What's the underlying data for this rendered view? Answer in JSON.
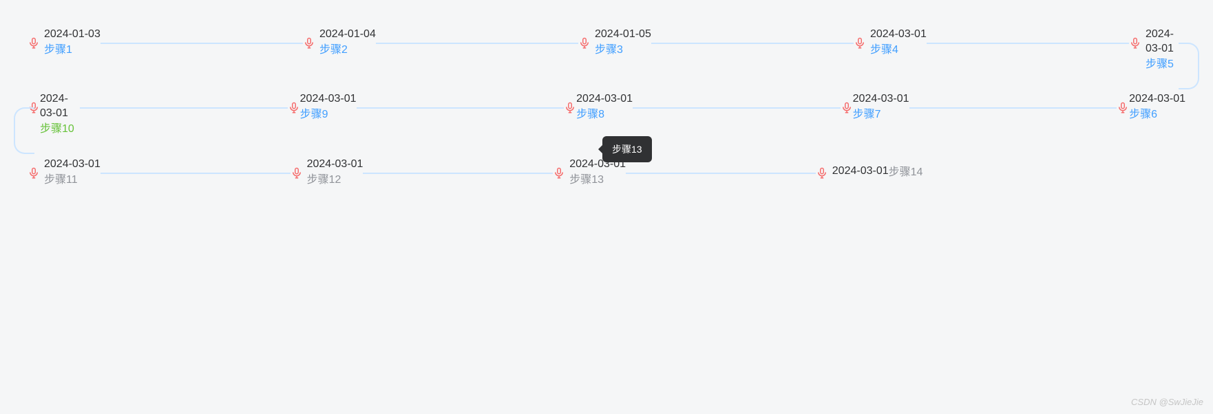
{
  "rows": [
    {
      "direction": "ltr",
      "items": [
        {
          "date": "2024-01-03",
          "step": "步骤1",
          "stepClass": "step-blue",
          "narrow": false
        },
        {
          "date": "2024-01-04",
          "step": "步骤2",
          "stepClass": "step-blue",
          "narrow": false
        },
        {
          "date": "2024-01-05",
          "step": "步骤3",
          "stepClass": "step-blue",
          "narrow": false
        },
        {
          "date": "2024-03-01",
          "step": "步骤4",
          "stepClass": "step-blue",
          "narrow": false
        },
        {
          "date": "2024-03-01",
          "step": "步骤5",
          "stepClass": "step-blue",
          "narrow": true
        }
      ],
      "snakeRight": true,
      "snakeLeft": false
    },
    {
      "direction": "rtl",
      "items": [
        {
          "date": "2024-03-01",
          "step": "步骤6",
          "stepClass": "step-blue",
          "narrow": false
        },
        {
          "date": "2024-03-01",
          "step": "步骤7",
          "stepClass": "step-blue",
          "narrow": false
        },
        {
          "date": "2024-03-01",
          "step": "步骤8",
          "stepClass": "step-blue",
          "narrow": false
        },
        {
          "date": "2024-03-01",
          "step": "步骤9",
          "stepClass": "step-blue",
          "narrow": false
        },
        {
          "date": "2024-03-01",
          "step": "步骤10",
          "stepClass": "step-green",
          "narrow": true
        }
      ],
      "snakeRight": false,
      "snakeLeft": true
    },
    {
      "direction": "ltr",
      "items": [
        {
          "date": "2024-03-01",
          "step": "步骤11",
          "stepClass": "step-gray",
          "narrow": false
        },
        {
          "date": "2024-03-01",
          "step": "步骤12",
          "stepClass": "step-gray",
          "narrow": false
        },
        {
          "date": "2024-03-01",
          "step": "步骤13",
          "stepClass": "step-gray",
          "narrow": false
        },
        {
          "date": "",
          "step": "",
          "stepClass": "",
          "narrow": false,
          "dateInline": "2024-03-01",
          "stepInline": "步骤14"
        }
      ],
      "snakeRight": false,
      "snakeLeft": false
    }
  ],
  "tooltip": {
    "text": "步骤13"
  },
  "watermark": "CSDN @SwJieJie",
  "iconColor": "#f56c6c"
}
